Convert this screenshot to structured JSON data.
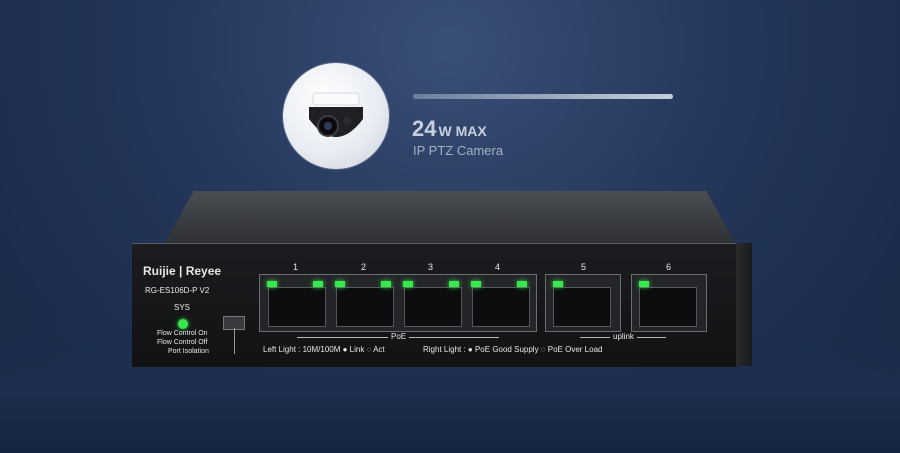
{
  "spec": {
    "power_value": "24",
    "power_unit": "W MAX",
    "camera_label": "IP  PTZ Camera"
  },
  "device": {
    "brand": "Ruijie | Reyee",
    "model": "RG-ES106D-P V2",
    "sys_label": "SYS",
    "modes": [
      "Flow Control On",
      "Flow Control Off",
      "Port Isolation"
    ],
    "ports": [
      "1",
      "2",
      "3",
      "4",
      "5",
      "6"
    ],
    "poe_label": "PoE",
    "uplink_label": "uplink",
    "left_light_legend": "Left Light : 10M/100M ● Link ◌ Act",
    "right_light_legend": "Right Light : ● PoE Good Supply ◌ PoE Over Load"
  }
}
